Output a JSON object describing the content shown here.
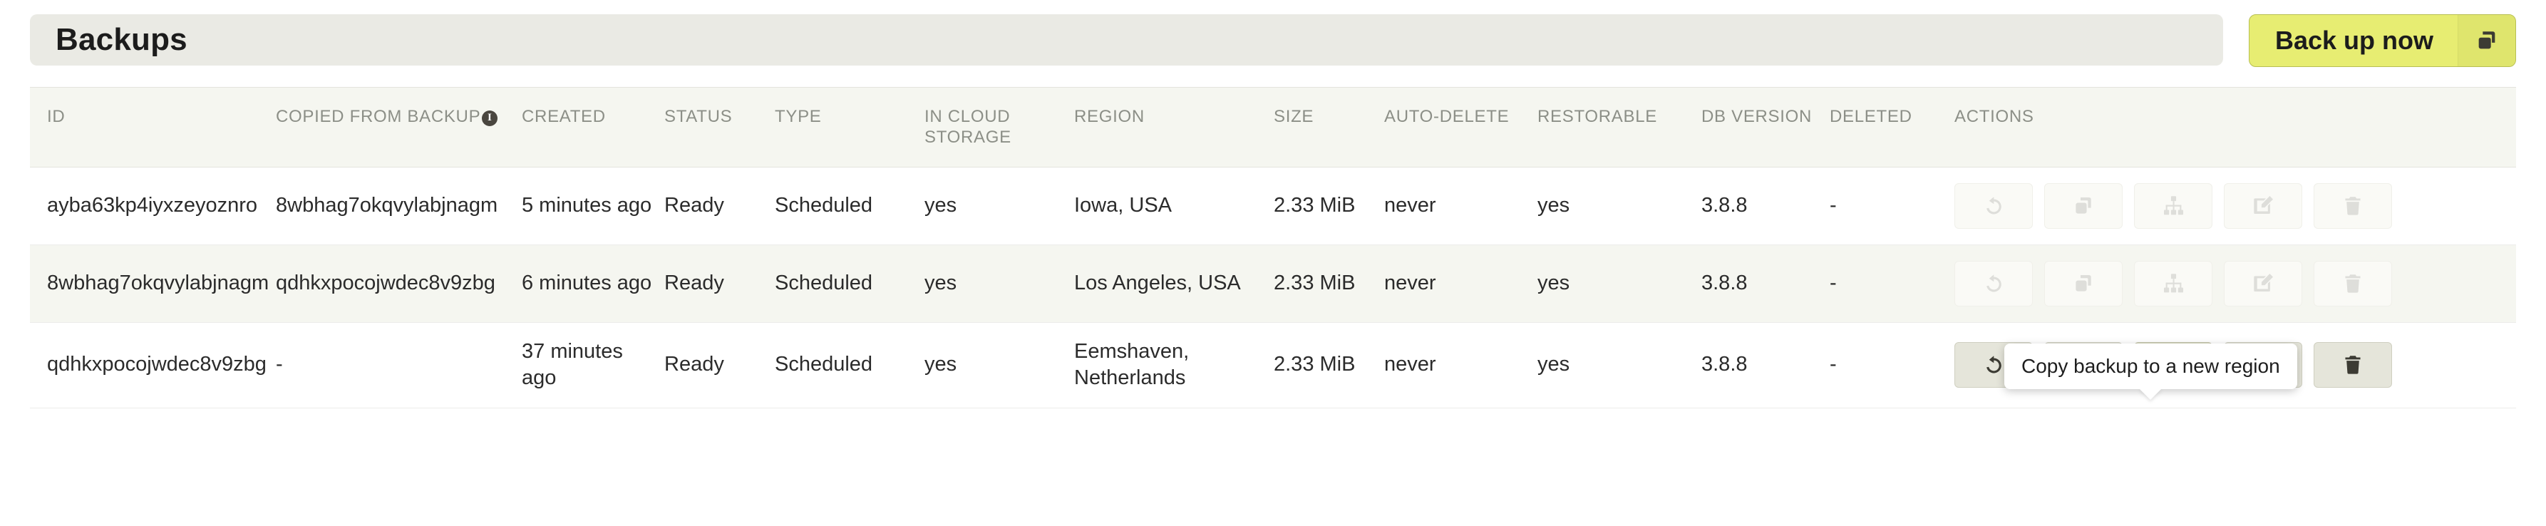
{
  "header": {
    "title": "Backups",
    "backup_now_label": "Back up now",
    "backup_now_icon": "copy-icon",
    "accent_color": "#e7ed72"
  },
  "table": {
    "columns": [
      {
        "key": "id",
        "label": "ID"
      },
      {
        "key": "copied",
        "label": "COPIED FROM BACKUP",
        "info": true,
        "info_glyph": "i"
      },
      {
        "key": "created",
        "label": "CREATED"
      },
      {
        "key": "status",
        "label": "STATUS"
      },
      {
        "key": "type",
        "label": "TYPE"
      },
      {
        "key": "cloud",
        "label": "IN CLOUD STORAGE"
      },
      {
        "key": "region",
        "label": "REGION"
      },
      {
        "key": "size",
        "label": "SIZE"
      },
      {
        "key": "auto",
        "label": "AUTO-DELETE"
      },
      {
        "key": "restore",
        "label": "RESTORABLE"
      },
      {
        "key": "dbver",
        "label": "DB VERSION"
      },
      {
        "key": "deleted",
        "label": "DELETED"
      },
      {
        "key": "actions",
        "label": "ACTIONS"
      }
    ],
    "rows": [
      {
        "id": "ayba63kp4iyxzeyoznro",
        "copied": "8wbhag7okqvylabjnagm",
        "created": "5 minutes ago",
        "status": "Ready",
        "type": "Scheduled",
        "cloud": "yes",
        "region": "Iowa, USA",
        "size": "2.33 MiB",
        "auto": "never",
        "restore": "yes",
        "dbver": "3.8.8",
        "deleted": "-",
        "actions_enabled": false
      },
      {
        "id": "8wbhag7okqvylabjnagm",
        "copied": "qdhkxpocojwdec8v9zbg",
        "created": "6 minutes ago",
        "status": "Ready",
        "type": "Scheduled",
        "cloud": "yes",
        "region": "Los Angeles, USA",
        "size": "2.33 MiB",
        "auto": "never",
        "restore": "yes",
        "dbver": "3.8.8",
        "deleted": "-",
        "actions_enabled": false
      },
      {
        "id": "qdhkxpocojwdec8v9zbg",
        "copied": "-",
        "created": "37 minutes ago",
        "status": "Ready",
        "type": "Scheduled",
        "cloud": "yes",
        "region": "Eemshaven, Netherlands",
        "size": "2.33 MiB",
        "auto": "never",
        "restore": "yes",
        "dbver": "3.8.8",
        "deleted": "-",
        "actions_enabled": true
      }
    ],
    "action_icons": [
      {
        "name": "restore-icon",
        "title": "Restore backup"
      },
      {
        "name": "copy-icon",
        "title": "Copy backup"
      },
      {
        "name": "sitemap-icon",
        "title": "Copy backup to a new region"
      },
      {
        "name": "edit-icon",
        "title": "Edit backup"
      },
      {
        "name": "trash-icon",
        "title": "Delete backup"
      }
    ]
  },
  "tooltip": {
    "text": "Copy backup to a new region"
  }
}
